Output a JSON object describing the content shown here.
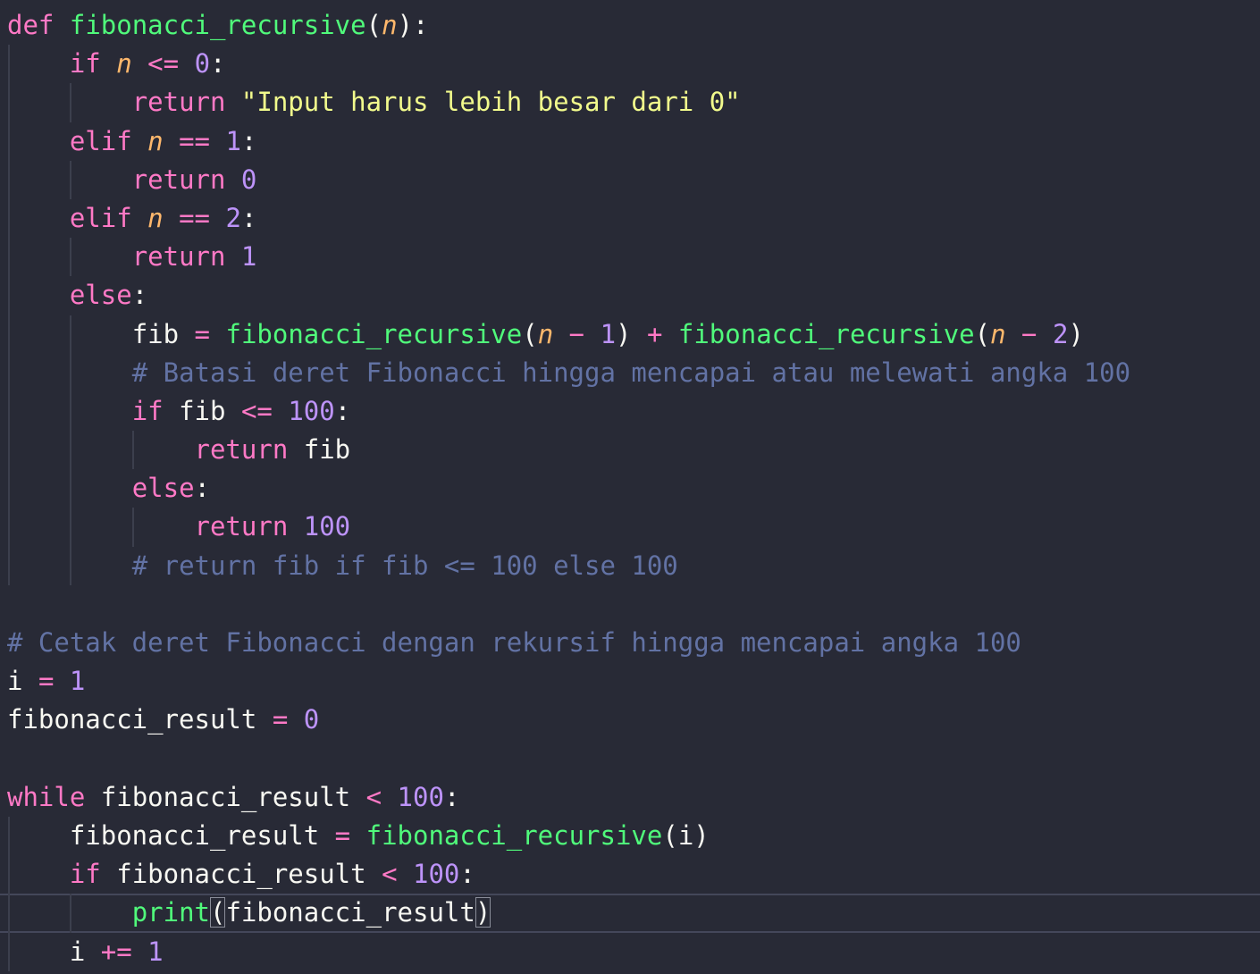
{
  "editor": {
    "language": "python",
    "theme": {
      "background": "#282a36",
      "keyword": "#ff79c6",
      "function": "#50fa7b",
      "parameter": "#ffb86c",
      "number": "#bd93f9",
      "string": "#f1fa8c",
      "comment": "#6272a4",
      "text": "#f8f8f2"
    },
    "current_line": 24,
    "lines": [
      "def fibonacci_recursive(n):",
      "    if n <= 0:",
      "        return \"Input harus lebih besar dari 0\"",
      "    elif n == 1:",
      "        return 0",
      "    elif n == 2:",
      "        return 1",
      "    else:",
      "        fib = fibonacci_recursive(n - 1) + fibonacci_recursive(n - 2)",
      "        # Batasi deret Fibonacci hingga mencapai atau melewati angka 100",
      "        if fib <= 100:",
      "            return fib",
      "        else:",
      "            return 100",
      "        # return fib if fib <= 100 else 100",
      "",
      "# Cetak deret Fibonacci dengan rekursif hingga mencapai angka 100",
      "i = 1",
      "fibonacci_result = 0",
      "",
      "while fibonacci_result < 100:",
      "    fibonacci_result = fibonacci_recursive(i)",
      "    if fibonacci_result < 100:",
      "        print(fibonacci_result)",
      "    i += 1"
    ]
  },
  "tokens": {
    "def": "def",
    "if": "if",
    "elif": "elif",
    "else": "else",
    "return": "return",
    "while": "while",
    "fn_name": "fibonacci_recursive",
    "print": "print",
    "param_n": "n",
    "var_fib": "fib",
    "var_i": "i",
    "var_result": "fibonacci_result",
    "op_le": "<=",
    "op_eq": "==",
    "op_lt": "<",
    "op_assign": "=",
    "op_plus": "+",
    "op_minus": "−",
    "op_iadd": "+=",
    "num_0": "0",
    "num_1": "1",
    "num_2": "2",
    "num_100": "100",
    "str_input": "\"Input harus lebih besar dari 0\"",
    "comment_batasi": "# Batasi deret Fibonacci hingga mencapai atau melewati angka 100",
    "comment_return": "# return fib if fib <= 100 else 100",
    "comment_cetak": "# Cetak deret Fibonacci dengan rekursif hingga mencapai angka 100"
  }
}
